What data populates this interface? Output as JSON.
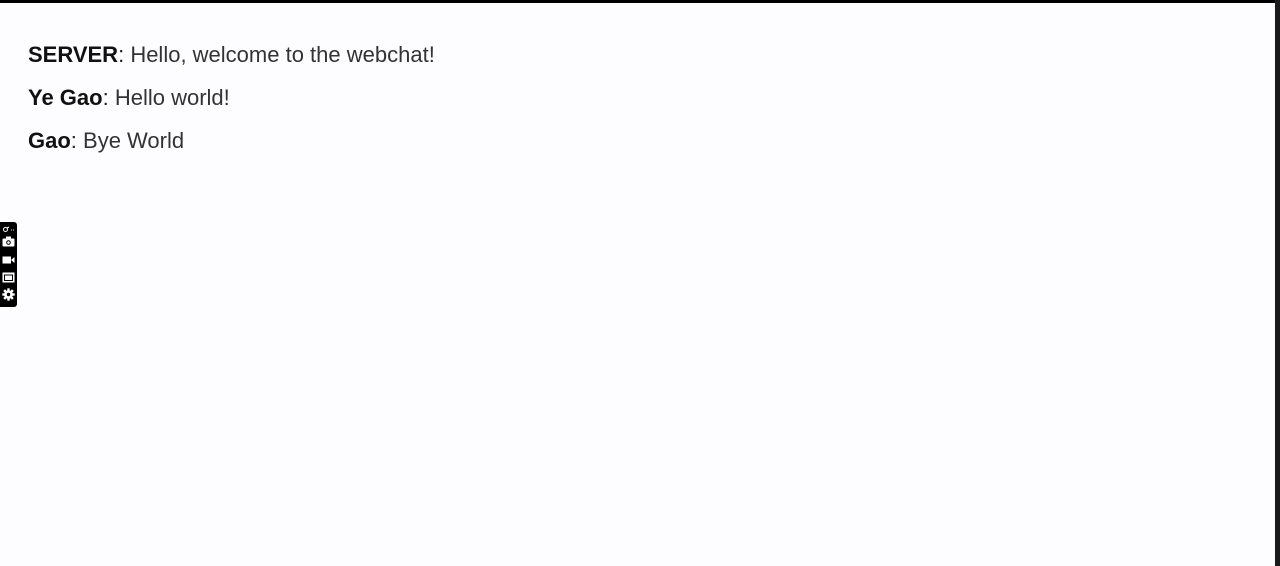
{
  "chat": {
    "messages": [
      {
        "author": "SERVER",
        "separator": ": ",
        "text": "Hello, welcome to the webchat!"
      },
      {
        "author": "Ye Gao",
        "separator": ": ",
        "text": "Hello world!"
      },
      {
        "author": "Gao",
        "separator": ": ",
        "text": "Bye World"
      }
    ]
  },
  "toolbar": {
    "items": [
      {
        "icon": "link-icon"
      },
      {
        "icon": "camera-icon"
      },
      {
        "icon": "video-icon"
      },
      {
        "icon": "window-icon"
      },
      {
        "icon": "gear-icon"
      }
    ]
  },
  "colors": {
    "frame": "#000000",
    "background": "#fdfdff",
    "author_text": "#111111",
    "message_text": "#333333"
  }
}
